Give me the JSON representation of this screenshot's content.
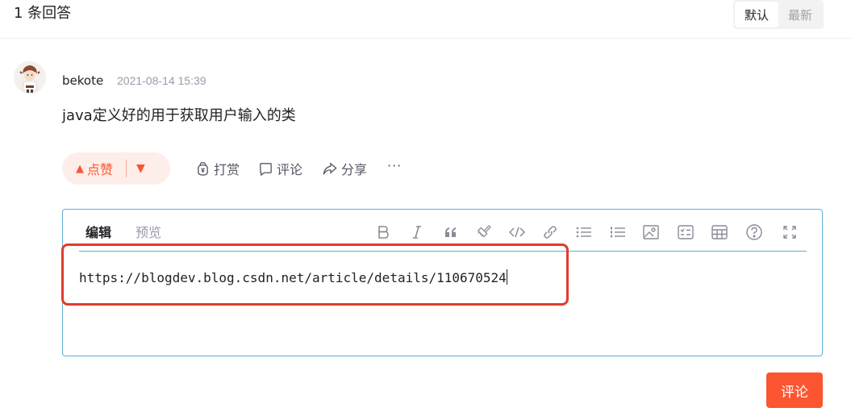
{
  "header": {
    "answer_count": "1 条回答",
    "sort_options": [
      "默认",
      "最新"
    ],
    "active_sort": "默认"
  },
  "answer": {
    "author": "bekote",
    "date": "2021-08-14 15:39",
    "text": "java定义好的用于获取用户输入的类",
    "like_label": "点赞",
    "actions": {
      "reward": "打赏",
      "comment": "评论",
      "share": "分享",
      "more": "···"
    }
  },
  "editor": {
    "tabs": {
      "edit": "编辑",
      "preview": "预览"
    },
    "active_tab": "编辑",
    "toolbar": [
      "bold-icon",
      "italic-icon",
      "quote-icon",
      "brush-icon",
      "code-icon",
      "link-icon",
      "unordered-list-icon",
      "ordered-list-icon",
      "image-icon",
      "checklist-icon",
      "table-icon",
      "help-icon",
      "fullscreen-icon"
    ],
    "content": "https://blogdev.blog.csdn.net/article/details/110670524"
  },
  "submit_label": "评论",
  "colors": {
    "accent": "#fc5531",
    "editor_border": "#5eb0d3",
    "highlight": "#e03c2a"
  }
}
